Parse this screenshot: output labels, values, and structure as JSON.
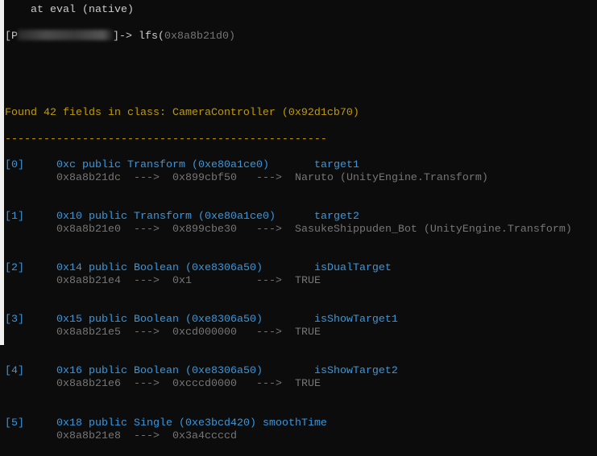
{
  "terminal": {
    "prev_line": "    at eval (native)",
    "prompt_prefix": "[P",
    "prompt_suffix": "]-> ",
    "command": "lfs(",
    "command_arg": "0x8a8b21d0)",
    "header": "Found 42 fields in class: CameraController (0x92d1cb70)",
    "separator": "--------------------------------------------------",
    "fields": [
      {
        "index": "[0]",
        "decl": "0xc public Transform (0xe80a1ce0)",
        "gap": "       ",
        "name": "target1",
        "addr": "0x8a8b21dc",
        "ptr": "0x899cbf50",
        "value": "Naruto (UnityEngine.Transform)"
      },
      {
        "index": "[1]",
        "decl": "0x10 public Transform (0xe80a1ce0)",
        "gap": "      ",
        "name": "target2",
        "addr": "0x8a8b21e0",
        "ptr": "0x899cbe30",
        "value": "SasukeShippuden_Bot (UnityEngine.Transform)"
      },
      {
        "index": "[2]",
        "decl": "0x14 public Boolean (0xe8306a50)",
        "gap": "        ",
        "name": "isDualTarget",
        "addr": "0x8a8b21e4",
        "ptr": "0x1       ",
        "value": "TRUE"
      },
      {
        "index": "[3]",
        "decl": "0x15 public Boolean (0xe8306a50)",
        "gap": "        ",
        "name": "isShowTarget1",
        "addr": "0x8a8b21e5",
        "ptr": "0xcd000000",
        "value": "TRUE"
      },
      {
        "index": "[4]",
        "decl": "0x16 public Boolean (0xe8306a50)",
        "gap": "        ",
        "name": "isShowTarget2",
        "addr": "0x8a8b21e6",
        "ptr": "0xcccd0000",
        "value": "TRUE"
      },
      {
        "index": "[5]",
        "decl": "0x18 public Single (0xe3bcd420)",
        "gap": " ",
        "name": "smoothTime",
        "addr": "0x8a8b21e8",
        "ptr": "0x3a4ccccd",
        "value": ""
      }
    ],
    "arrow": "--->"
  }
}
